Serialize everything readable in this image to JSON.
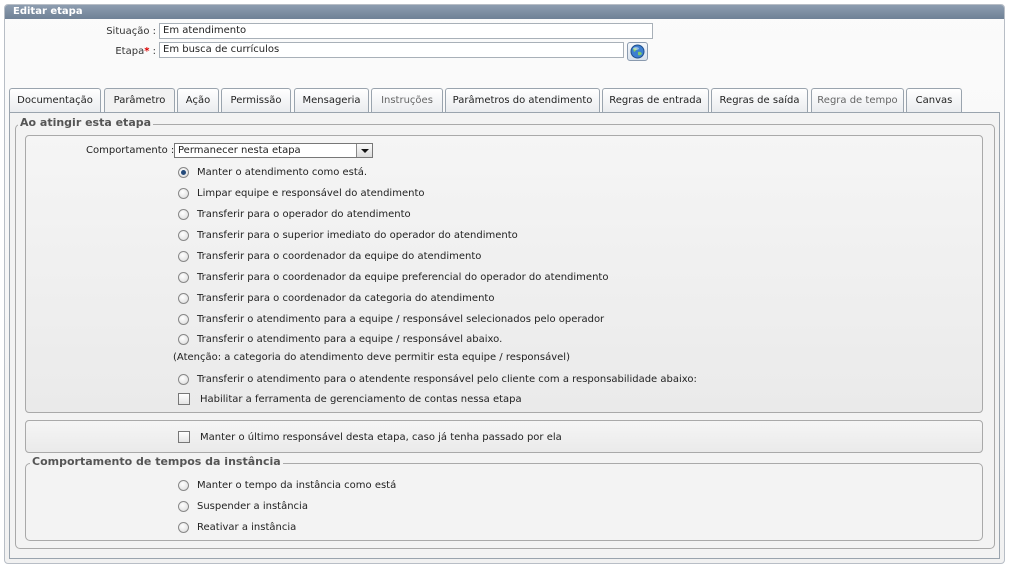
{
  "window": {
    "title": "Editar etapa"
  },
  "form": {
    "situacao_label": "Situação :",
    "situacao_value": "Em atendimento",
    "etapa_label": "Etapa",
    "etapa_required": "*",
    "etapa_colon": " :",
    "etapa_value": "Em busca de currículos"
  },
  "tabs": [
    {
      "label": "Documentação",
      "state": "normal"
    },
    {
      "label": "Parâmetro",
      "state": "active"
    },
    {
      "label": "Ação",
      "state": "normal"
    },
    {
      "label": "Permissão",
      "state": "normal"
    },
    {
      "label": "Mensageria",
      "state": "normal"
    },
    {
      "label": "Instruções",
      "state": "disabled"
    },
    {
      "label": "Parâmetros do atendimento",
      "state": "normal"
    },
    {
      "label": "Regras de entrada",
      "state": "normal"
    },
    {
      "label": "Regras de saída",
      "state": "normal"
    },
    {
      "label": "Regra de tempo",
      "state": "disabled"
    },
    {
      "label": "Canvas",
      "state": "normal"
    }
  ],
  "section_atingir": {
    "legend": "Ao atingir esta etapa",
    "comportamento_label": "Comportamento :",
    "comportamento_value": "Permanecer nesta etapa",
    "options": [
      {
        "label": "Manter o atendimento como está.",
        "selected": true
      },
      {
        "label": "Limpar equipe e responsável do atendimento",
        "selected": false
      },
      {
        "label": "Transferir para o operador do atendimento",
        "selected": false
      },
      {
        "label": "Transferir para o superior imediato do operador do atendimento",
        "selected": false
      },
      {
        "label": "Transferir para o coordenador da equipe do atendimento",
        "selected": false
      },
      {
        "label": "Transferir para o coordenador da equipe preferencial do operador do atendimento",
        "selected": false
      },
      {
        "label": "Transferir para o coordenador da categoria do atendimento",
        "selected": false
      },
      {
        "label": "Transferir o atendimento para a equipe / responsável selecionados pelo operador",
        "selected": false
      },
      {
        "label": "Transferir o atendimento para a equipe / responsável abaixo.",
        "selected": false
      }
    ],
    "attention_note": "(Atenção: a categoria do atendimento deve permitir esta equipe / responsável)",
    "option_cliente": "Transferir o atendimento para o atendente responsável pelo cliente com a responsabilidade abaixo:",
    "check_contas": "Habilitar a ferramenta de gerenciamento de contas nessa etapa",
    "check_contas_checked": false
  },
  "ultimo_responsavel": {
    "label": "Manter o último responsável desta etapa, caso já tenha passado por ela",
    "checked": false
  },
  "section_tempos": {
    "legend": "Comportamento de tempos da instância",
    "options": [
      {
        "label": "Manter o tempo da instância como está",
        "selected": false
      },
      {
        "label": "Suspender a instância",
        "selected": false
      },
      {
        "label": "Reativar a instância",
        "selected": false
      }
    ]
  },
  "icons": {
    "lookup_button": "globe-icon"
  },
  "colors": {
    "titlebar": "#7b8ca1",
    "required": "#dd0000",
    "radio_selected": "#244a7a"
  }
}
